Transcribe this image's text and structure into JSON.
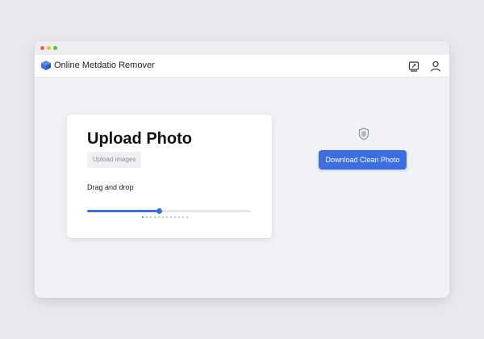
{
  "app": {
    "title": "Online Metdatio Remover"
  },
  "upload_card": {
    "title": "Upload Photo",
    "upload_button_label": "Upload images",
    "drag_label": "Drag and drop",
    "progress_fraction": 0.44,
    "pager_dot_count": 12,
    "pager_active_index": 0
  },
  "actions": {
    "download_label": "Download Clean Photo"
  },
  "icons": {
    "logo": "cube-logo-icon",
    "history": "history-icon",
    "profile": "user-icon",
    "shield": "shield-icon"
  },
  "colors": {
    "accent": "#3d6ee0",
    "logo": "#3a74d8"
  }
}
